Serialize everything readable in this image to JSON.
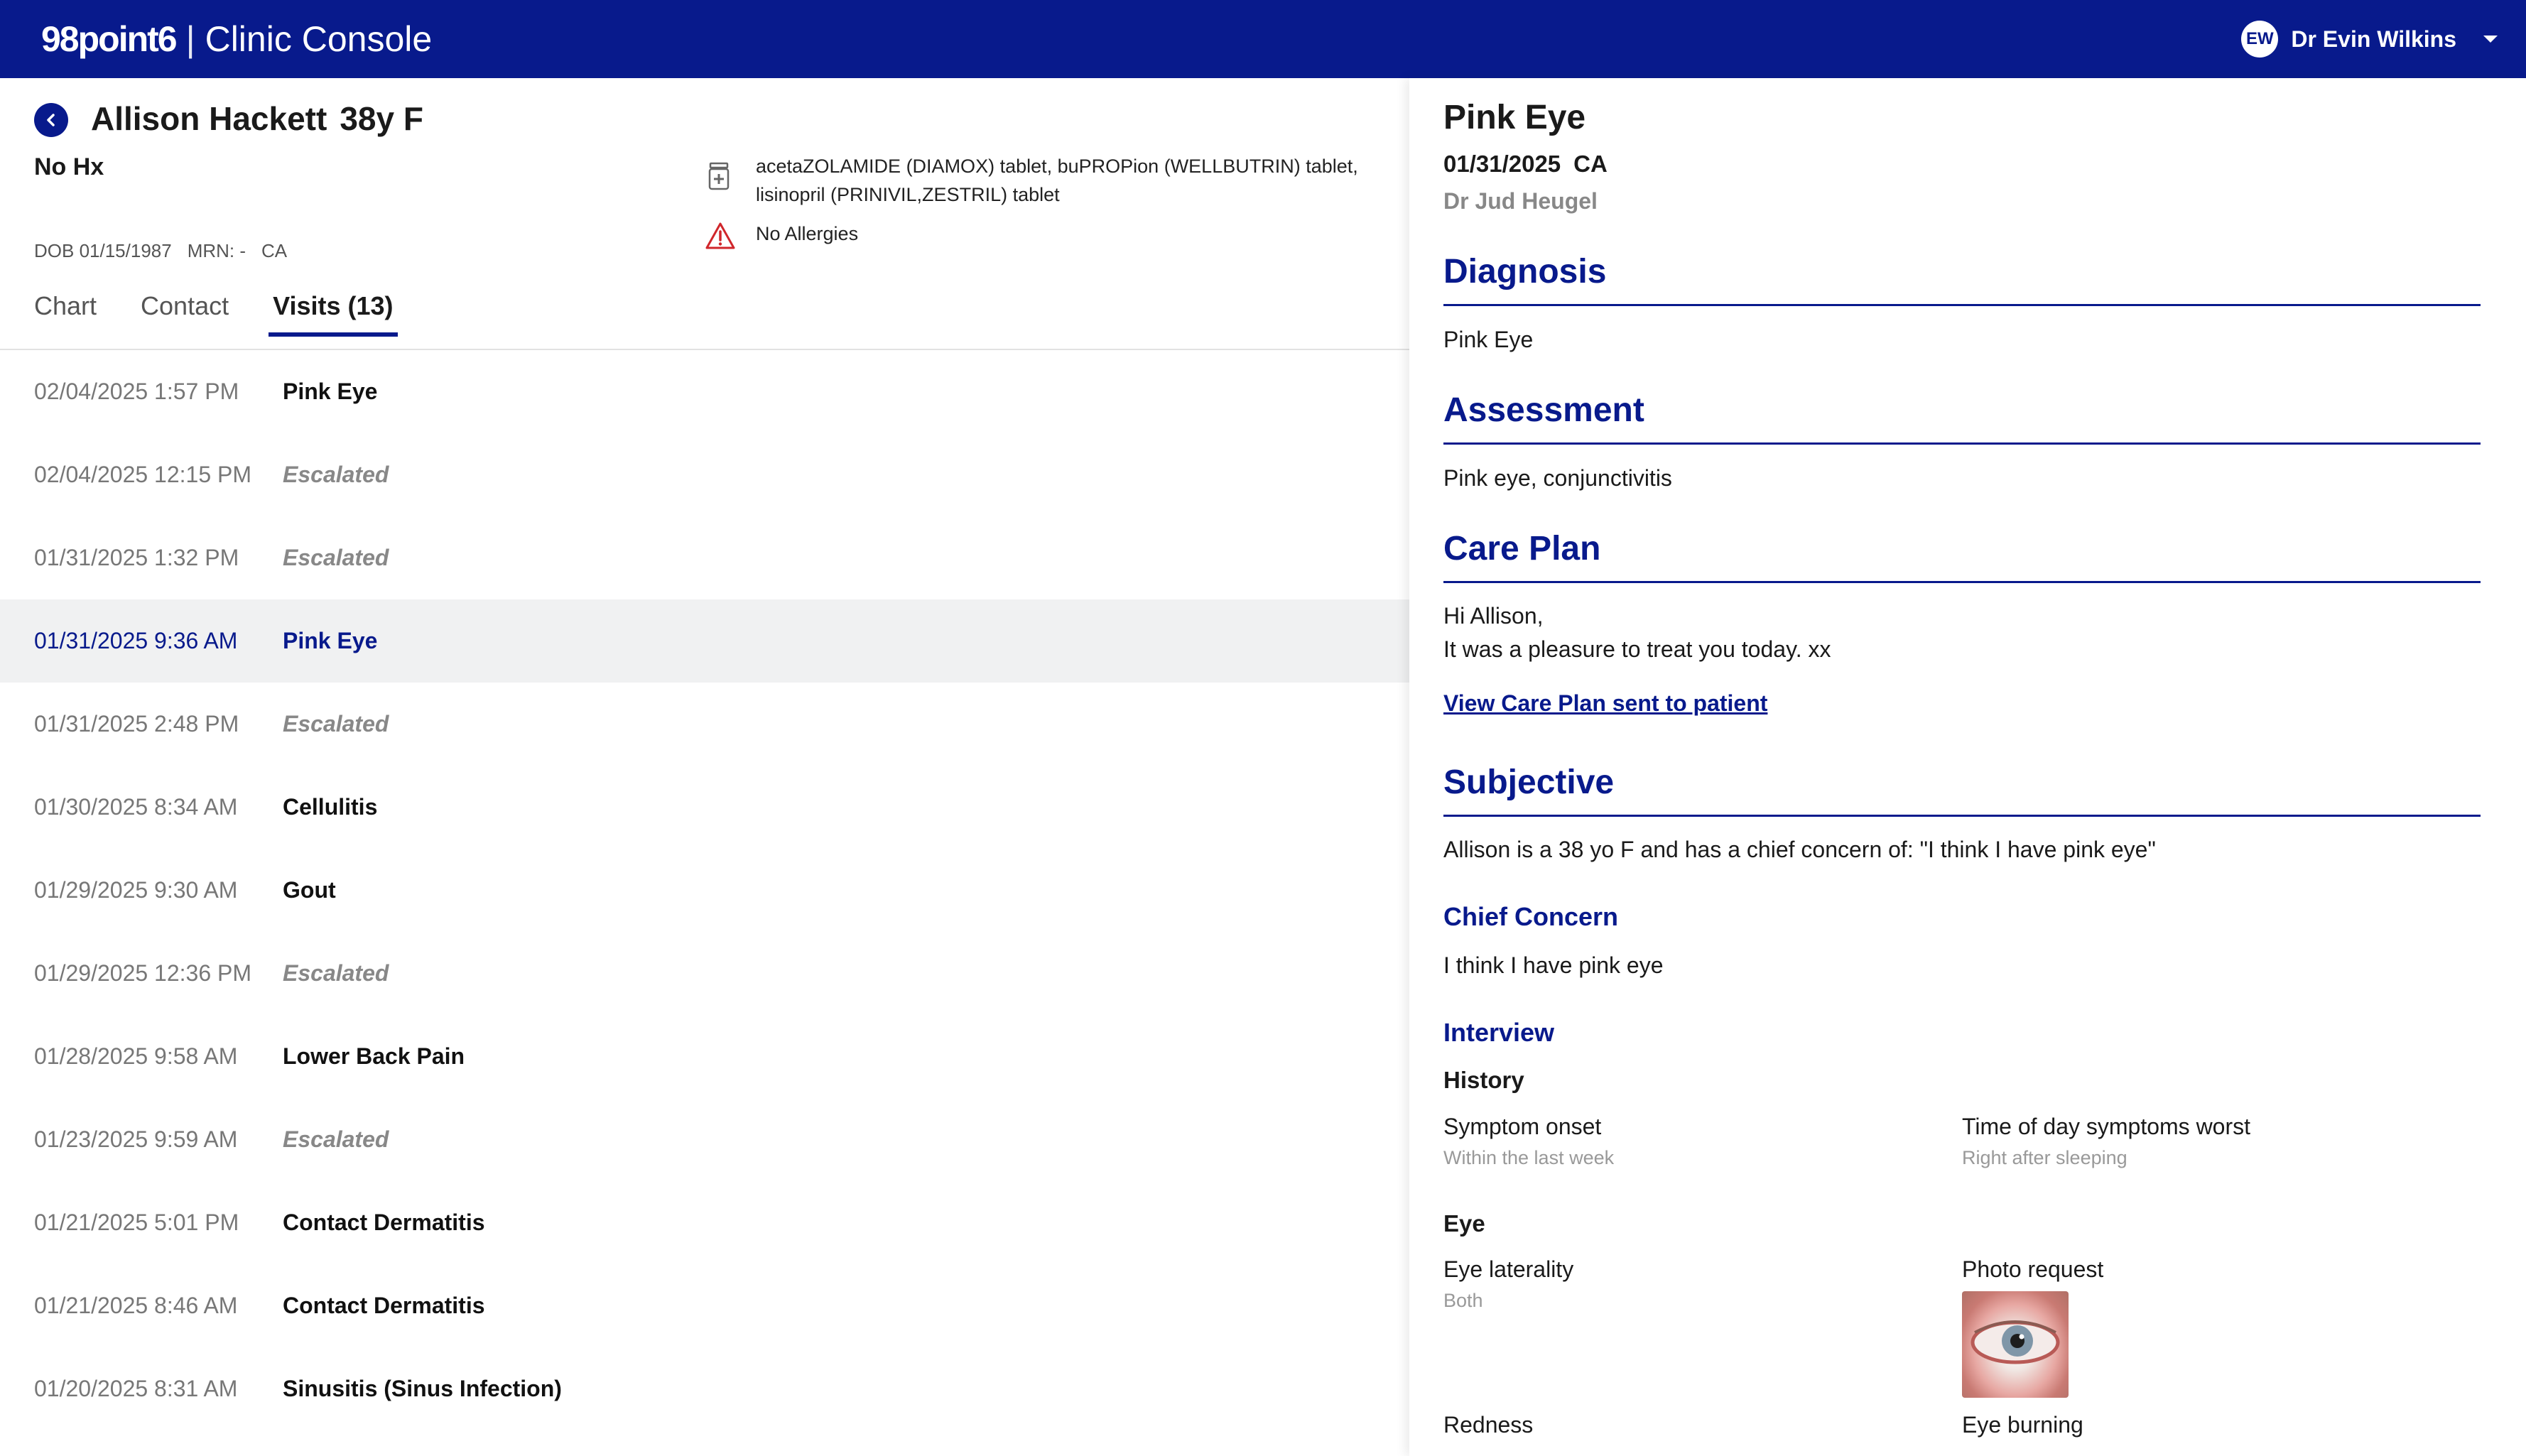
{
  "app": {
    "logo": "98point6",
    "separator": "|",
    "title": "Clinic Console"
  },
  "user": {
    "initials": "EW",
    "name": "Dr Evin Wilkins"
  },
  "patient": {
    "name": "Allison Hackett",
    "age_sex": "38y F",
    "history": "No Hx",
    "dob": "DOB 01/15/1987",
    "mrn": "MRN: -",
    "state": "CA",
    "medications": "acetaZOLAMIDE (DIAMOX) tablet, buPROPion (WELLBUTRIN) tablet, lisinopril (PRINIVIL,ZESTRIL) tablet",
    "allergies": "No Allergies"
  },
  "tabs": [
    {
      "label": "Chart"
    },
    {
      "label": "Contact"
    },
    {
      "label": "Visits (13)",
      "active": true
    }
  ],
  "visits": [
    {
      "date": "02/04/2025 1:57 PM",
      "title": "Pink Eye",
      "escalated": false
    },
    {
      "date": "02/04/2025 12:15 PM",
      "title": "Escalated",
      "escalated": true
    },
    {
      "date": "01/31/2025 1:32 PM",
      "title": "Escalated",
      "escalated": true
    },
    {
      "date": "01/31/2025 9:36 AM",
      "title": "Pink Eye",
      "escalated": false,
      "selected": true
    },
    {
      "date": "01/31/2025 2:48 PM",
      "title": "Escalated",
      "escalated": true
    },
    {
      "date": "01/30/2025 8:34 AM",
      "title": "Cellulitis",
      "escalated": false
    },
    {
      "date": "01/29/2025 9:30 AM",
      "title": "Gout",
      "escalated": false
    },
    {
      "date": "01/29/2025 12:36 PM",
      "title": "Escalated",
      "escalated": true
    },
    {
      "date": "01/28/2025 9:58 AM",
      "title": "Lower Back Pain",
      "escalated": false
    },
    {
      "date": "01/23/2025 9:59 AM",
      "title": "Escalated",
      "escalated": true
    },
    {
      "date": "01/21/2025 5:01 PM",
      "title": "Contact Dermatitis",
      "escalated": false
    },
    {
      "date": "01/21/2025 8:46 AM",
      "title": "Contact Dermatitis",
      "escalated": false
    },
    {
      "date": "01/20/2025 8:31 AM",
      "title": "Sinusitis (Sinus Infection)",
      "escalated": false
    }
  ],
  "detail": {
    "title": "Pink Eye",
    "date": "01/31/2025",
    "state": "CA",
    "doctor": "Dr Jud Heugel",
    "diagnosis": {
      "heading": "Diagnosis",
      "text": "Pink Eye"
    },
    "assessment": {
      "heading": "Assessment",
      "text": "Pink eye, conjunctivitis"
    },
    "care_plan": {
      "heading": "Care Plan",
      "line1": "Hi Allison,",
      "line2": "It was a pleasure to treat you today. xx",
      "link": "View Care Plan sent to patient"
    },
    "subjective": {
      "heading": "Subjective",
      "text": "Allison is a 38 yo F and has a chief concern of: \"I think I have pink eye\""
    },
    "chief_concern": {
      "heading": "Chief Concern",
      "text": "I think I have pink eye"
    },
    "interview": {
      "heading": "Interview",
      "history_heading": "History",
      "symptom_onset_label": "Symptom onset",
      "symptom_onset_value": "Within the last week",
      "time_of_day_label": "Time of day symptoms worst",
      "time_of_day_value": "Right after sleeping",
      "eye_heading": "Eye",
      "eye_laterality_label": "Eye laterality",
      "eye_laterality_value": "Both",
      "photo_request_label": "Photo request",
      "redness_label": "Redness",
      "eye_burning_label": "Eye burning"
    }
  },
  "colors": {
    "brand": "#081a8c",
    "selected_row": "#f0f1f2",
    "alert": "#d0262b"
  },
  "icons": {
    "back": "chevron-left-icon",
    "medication": "pill-bottle-icon",
    "allergy": "warning-triangle-icon",
    "dropdown": "caret-down-icon"
  }
}
